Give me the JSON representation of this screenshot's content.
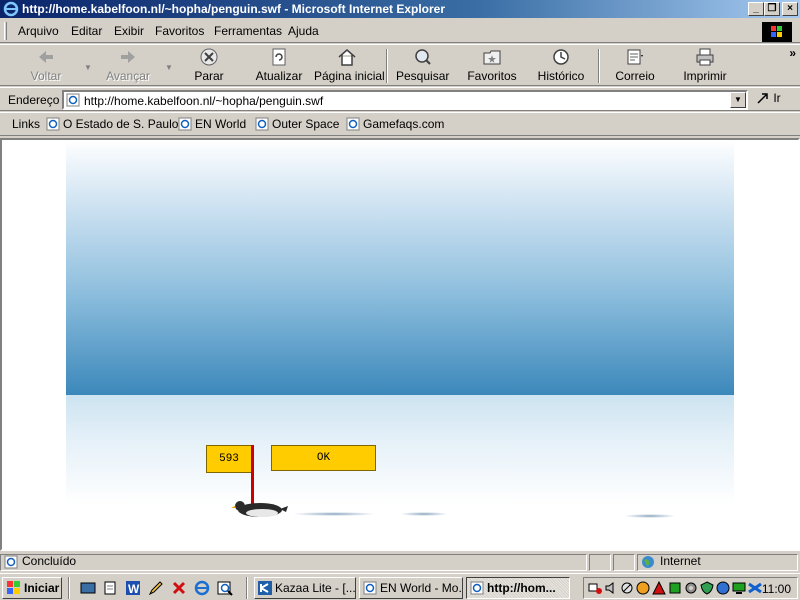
{
  "window": {
    "title": "http://home.kabelfoon.nl/~hopha/penguin.swf - Microsoft Internet Explorer",
    "minimize": "_",
    "maximize": "❐",
    "close": "×"
  },
  "menu": [
    "Arquivo",
    "Editar",
    "Exibir",
    "Favoritos",
    "Ferramentas",
    "Ajuda"
  ],
  "toolbar": {
    "back": "Voltar",
    "forward": "Avançar",
    "stop": "Parar",
    "refresh": "Atualizar",
    "home": "Página inicial",
    "search": "Pesquisar",
    "favorites": "Favoritos",
    "history": "Histórico",
    "mail": "Correio",
    "print": "Imprimir",
    "more": "»"
  },
  "address": {
    "label": "Endereço",
    "url": "http://home.kabelfoon.nl/~hopha/penguin.swf",
    "go": "Ir"
  },
  "links": {
    "label": "Links",
    "items": [
      "O Estado de S. Paulo",
      "EN World",
      "Outer Space",
      "Gamefaqs.com"
    ]
  },
  "game": {
    "score": "593",
    "ok_label": "OK"
  },
  "status": {
    "text": "Concluído",
    "zone": "Internet"
  },
  "taskbar": {
    "start": "Iniciar",
    "tasks": [
      "Kazaa Lite - [...",
      "EN World - Mo...",
      "http://hom..."
    ],
    "clock": "11:00"
  },
  "colors": {
    "title_start": "#0a246a",
    "title_end": "#a6caf0",
    "chrome": "#d4d0c8",
    "sign_yellow": "#ffcc00",
    "pole_red": "#cc0000",
    "sky_dark": "#3c88bb"
  }
}
